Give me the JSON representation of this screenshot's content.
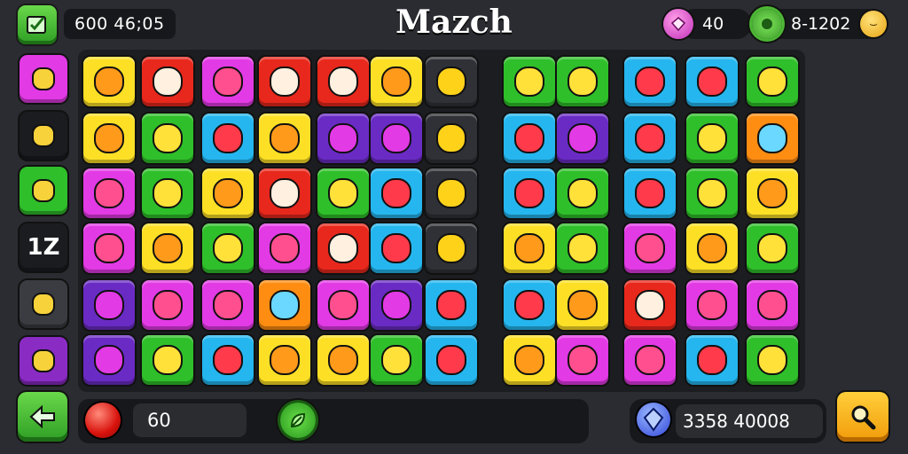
{
  "header": {
    "timer": "600 46;05",
    "title": "Mazch",
    "gems": "40",
    "coins": "8-1202"
  },
  "footer": {
    "moves": "60",
    "score": "3358 40008"
  },
  "side_items": [
    {
      "name": "fruit-tile-icon",
      "color": "#e23ae5",
      "label": ""
    },
    {
      "name": "crossed-tools-icon",
      "color": "#1b1c20",
      "label": ""
    },
    {
      "name": "candy-icon",
      "color": "#2fbf2a",
      "label": ""
    },
    {
      "name": "level-badge",
      "color": "#1b1c20",
      "label": "1Z"
    },
    {
      "name": "phone-icon",
      "color": "#3a3c41",
      "label": ""
    },
    {
      "name": "pencil-icon",
      "color": "#8a2bc4",
      "label": ""
    }
  ],
  "colors": {
    "accent_green": "#2fbf2a",
    "accent_gold": "#f5c51a",
    "board": "#1c1d21"
  }
}
